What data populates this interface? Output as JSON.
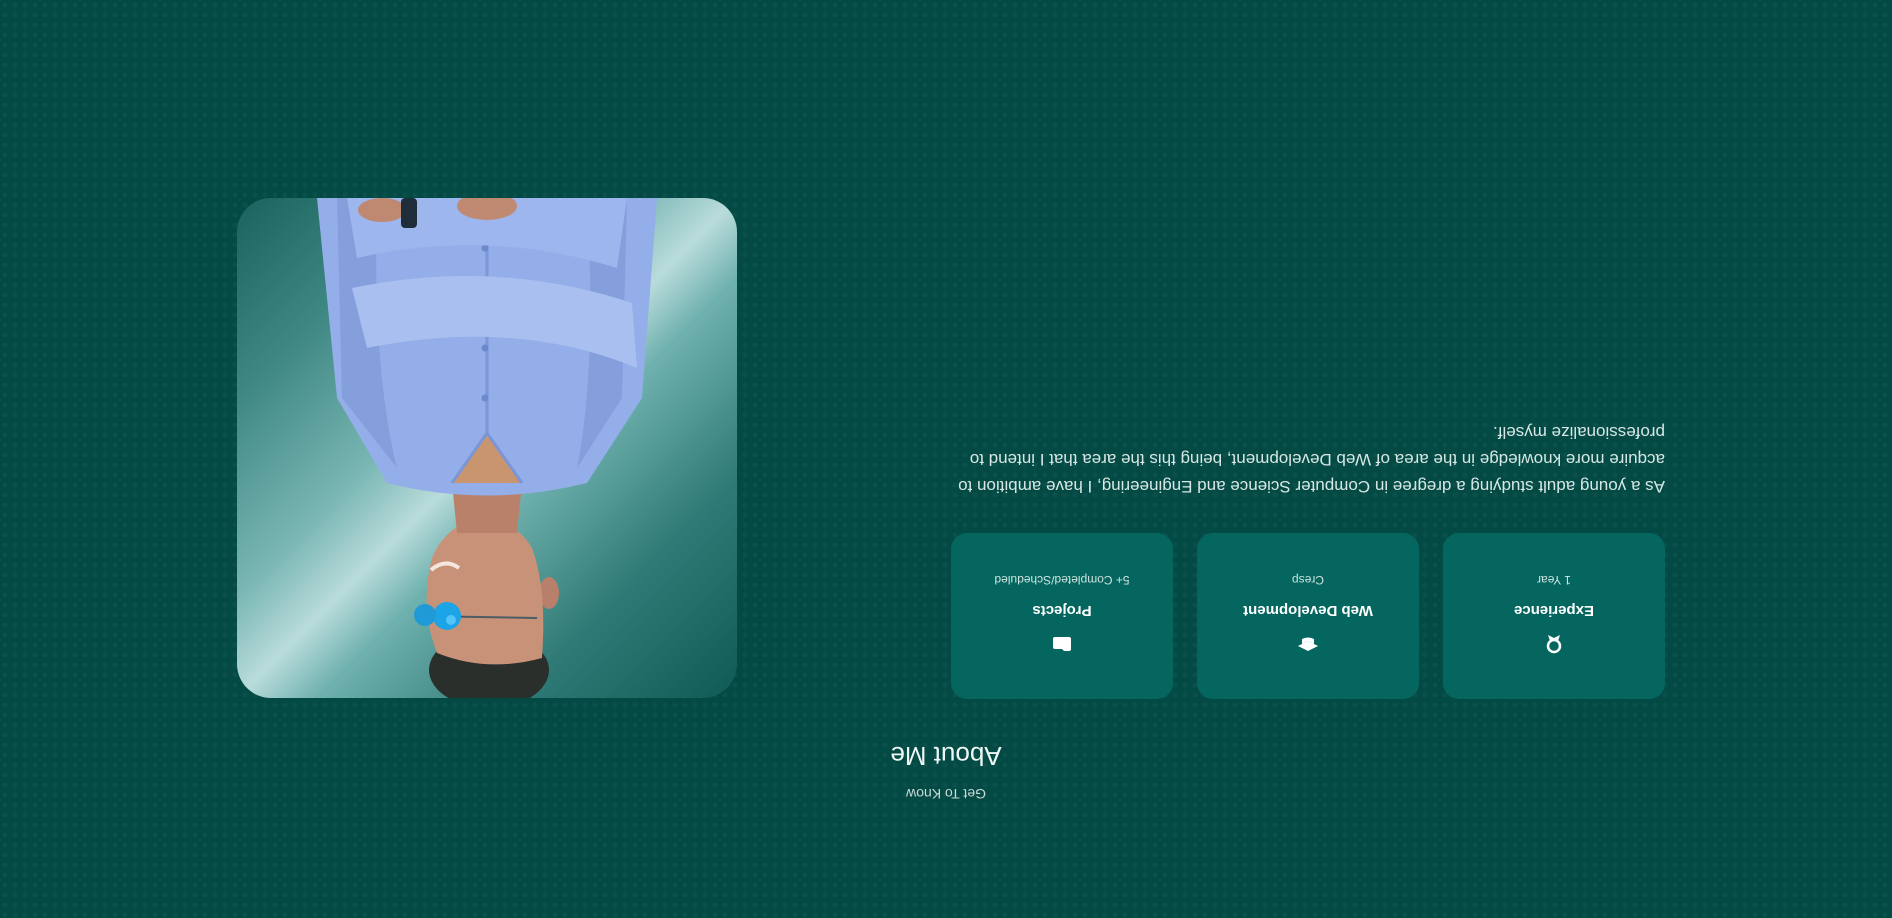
{
  "header": {
    "subtitle": "Get To Know",
    "title": "About Me"
  },
  "cards": [
    {
      "icon": "award-icon",
      "title": "Experience",
      "value": "1 Year"
    },
    {
      "icon": "graduation-cap-icon",
      "title": "Web Development",
      "value": "Cresp"
    },
    {
      "icon": "folder-icon",
      "title": "Projects",
      "value": "5+ Completed/Scheduled"
    }
  ],
  "description": "As a young adult studying a dregree in Computer Science and Engineering, I have ambition to acquire more knowledge in the area of Web Development, being this the area that I intend to professionalize myself.",
  "colors": {
    "background": "#034a44",
    "card": "#04665f",
    "text": "#e6f2ef"
  }
}
